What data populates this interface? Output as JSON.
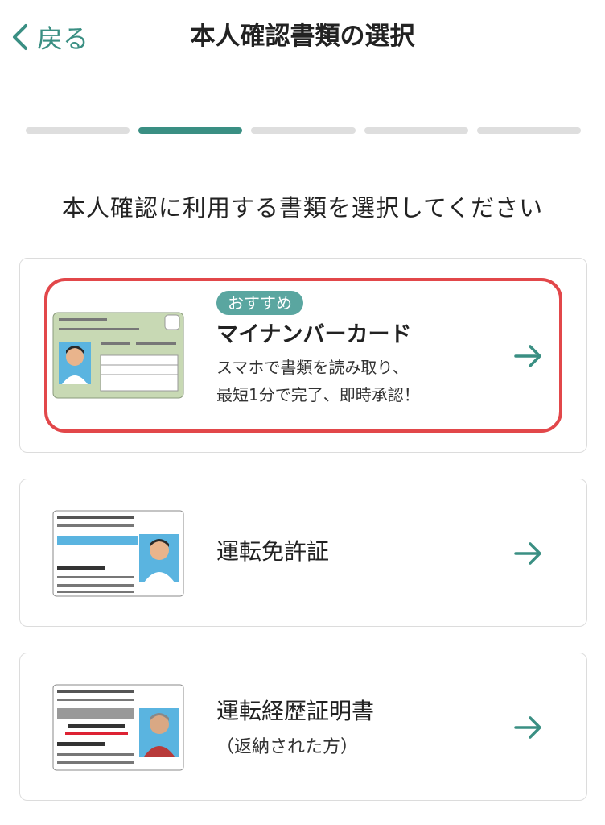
{
  "header": {
    "back_label": "戻る",
    "title": "本人確認書類の選択"
  },
  "progress": {
    "total_steps": 5,
    "current_step": 2
  },
  "prompt": "本人確認に利用する書類を選択してください",
  "cards": [
    {
      "badge": "おすすめ",
      "title": "マイナンバーカード",
      "desc_line1": "スマホで書類を読み取り、",
      "desc_line2": "最短1分で完了、即時承認！",
      "icon": "my-number-card-image"
    },
    {
      "title": "運転免許証",
      "icon": "drivers-license-image"
    },
    {
      "title": "運転経歴証明書",
      "subtitle": "（返納された方）",
      "icon": "driving-history-certificate-image"
    }
  ],
  "colors": {
    "accent": "#3a8f83",
    "badge": "#5aa6a0",
    "highlight": "#e2474a",
    "inactive_step": "#dedede"
  }
}
